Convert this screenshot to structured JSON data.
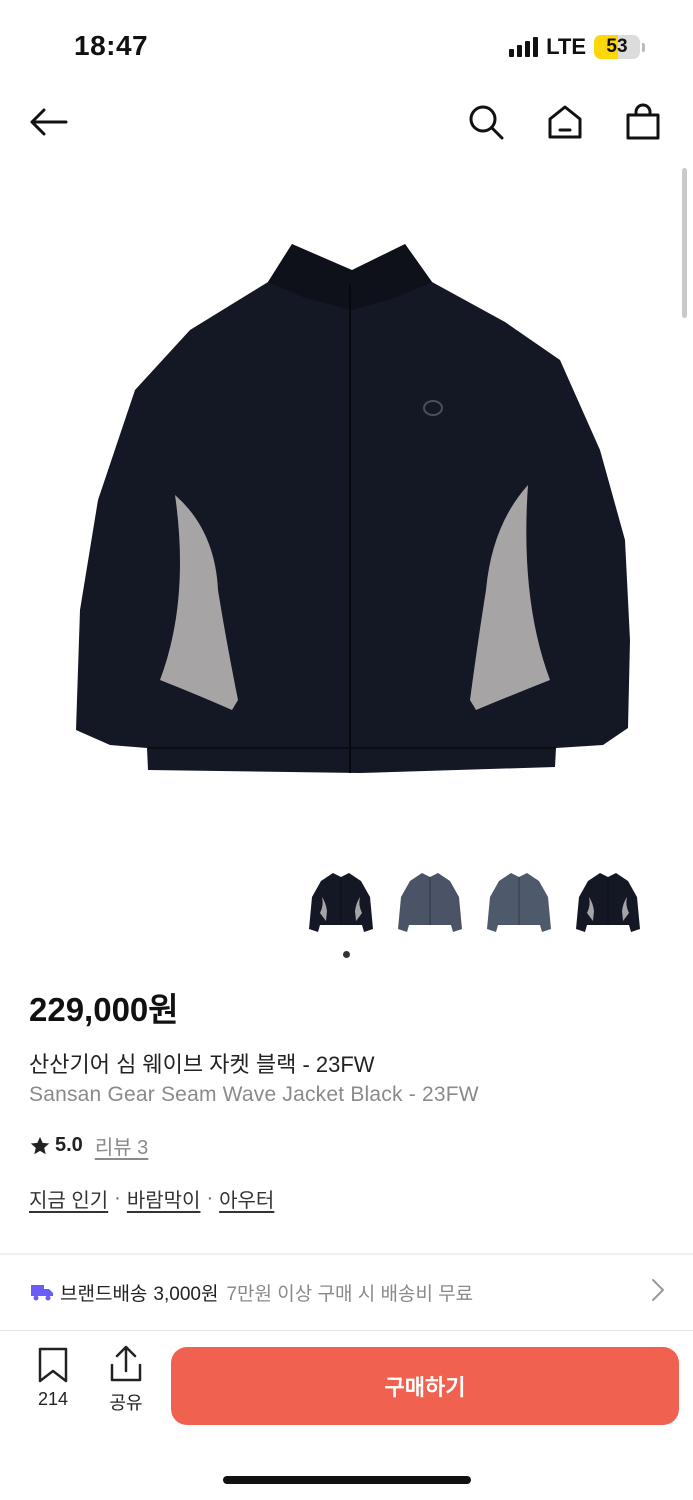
{
  "status_bar": {
    "time": "18:47",
    "network": "LTE",
    "battery": "53",
    "battery_level_percent": 53,
    "battery_color": "#ffd60a"
  },
  "top_nav": {
    "icons": [
      "back-arrow-icon",
      "search-icon",
      "home-icon",
      "shopping-bag-icon"
    ]
  },
  "gallery": {
    "thumbnails": [
      {
        "name": "thumbnail-black-gray-front",
        "color": "#141824"
      },
      {
        "name": "thumbnail-navy-blue-front",
        "color": "#4a5466"
      },
      {
        "name": "thumbnail-navy-blue-side",
        "color": "#4e596b"
      },
      {
        "name": "thumbnail-black-gray-back",
        "color": "#141824"
      }
    ],
    "active_index": 0
  },
  "product": {
    "price": "229,000원",
    "name_ko": "산산기어 심 웨이브 자켓 블랙 - 23FW",
    "name_en": "Sansan Gear Seam Wave Jacket Black - 23FW",
    "rating": "5.0",
    "review_link": "리뷰 3",
    "tags": [
      "지금 인기",
      "바람막이",
      "아우터"
    ],
    "tag_separator": "·"
  },
  "shipping": {
    "label": "브랜드배송",
    "fee": "3,000원",
    "note": "7만원 이상 구매 시 배송비 무료",
    "icon_color": "#6b5cf6"
  },
  "bottom_bar": {
    "like_count": "214",
    "share_label": "공유",
    "buy_label": "구매하기",
    "buy_color": "#f0614f"
  }
}
